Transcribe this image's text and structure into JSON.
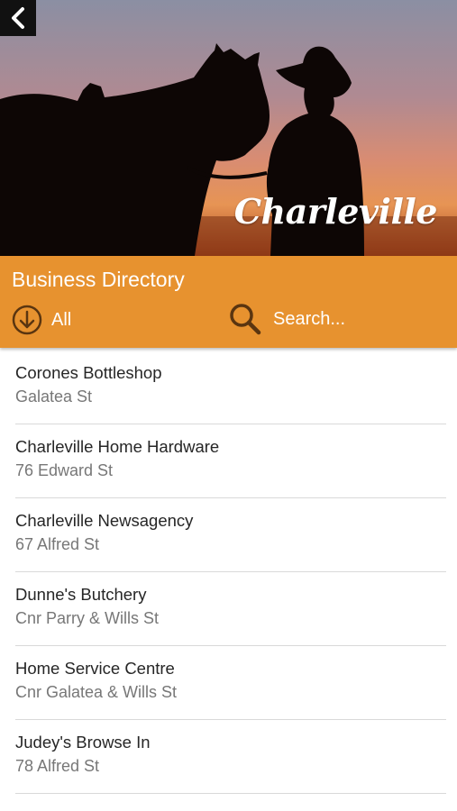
{
  "hero": {
    "logo_text": "Charleville",
    "back_icon": "chevron-left-icon"
  },
  "header": {
    "title": "Business Directory",
    "filter_label": "All",
    "filter_icon": "circle-arrow-down-icon",
    "search_placeholder": "Search...",
    "search_icon": "search-icon"
  },
  "colors": {
    "header_bg": "#e7922f",
    "divider": "#d9d9d9",
    "name_text": "#262626",
    "address_text": "#777777"
  },
  "businesses": [
    {
      "name": "Corones Bottleshop",
      "address": "Galatea St"
    },
    {
      "name": "Charleville Home Hardware",
      "address": "76 Edward St"
    },
    {
      "name": "Charleville Newsagency",
      "address": "67 Alfred St"
    },
    {
      "name": "Dunne's Butchery",
      "address": "Cnr Parry & Wills St"
    },
    {
      "name": "Home Service Centre",
      "address": "Cnr Galatea & Wills St"
    },
    {
      "name": "Judey's Browse In",
      "address": "78 Alfred St"
    }
  ]
}
